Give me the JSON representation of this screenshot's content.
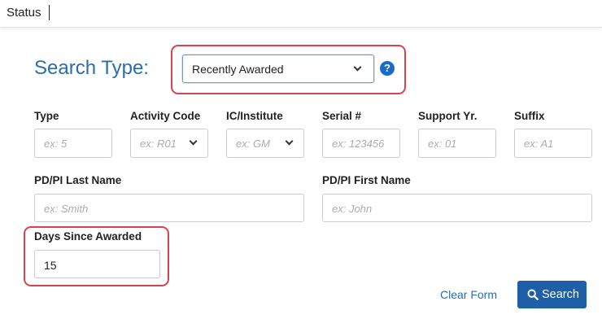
{
  "header": {
    "tab_label": "Status"
  },
  "search_type": {
    "label": "Search Type:",
    "selected": "Recently Awarded"
  },
  "help_icon": {
    "glyph": "?"
  },
  "fields": {
    "type": {
      "label": "Type",
      "placeholder": "ex: 5"
    },
    "activity_code": {
      "label": "Activity Code",
      "placeholder": "ex: R01"
    },
    "ic_institute": {
      "label": "IC/Institute",
      "placeholder": "ex: GM"
    },
    "serial": {
      "label": "Serial #",
      "placeholder": "ex: 123456"
    },
    "support_yr": {
      "label": "Support Yr.",
      "placeholder": "ex: 01"
    },
    "suffix": {
      "label": "Suffix",
      "placeholder": "ex: A1"
    },
    "pi_last": {
      "label": "PD/PI Last Name",
      "placeholder": "ex: Smith"
    },
    "pi_first": {
      "label": "PD/PI First Name",
      "placeholder": "ex: John"
    },
    "days_since": {
      "label": "Days Since Awarded",
      "value": "15"
    }
  },
  "actions": {
    "clear_label": "Clear Form",
    "search_label": "Search"
  },
  "colors": {
    "accent": "#2b6cb0",
    "button": "#1f5fa8",
    "highlight": "#d9434f"
  }
}
